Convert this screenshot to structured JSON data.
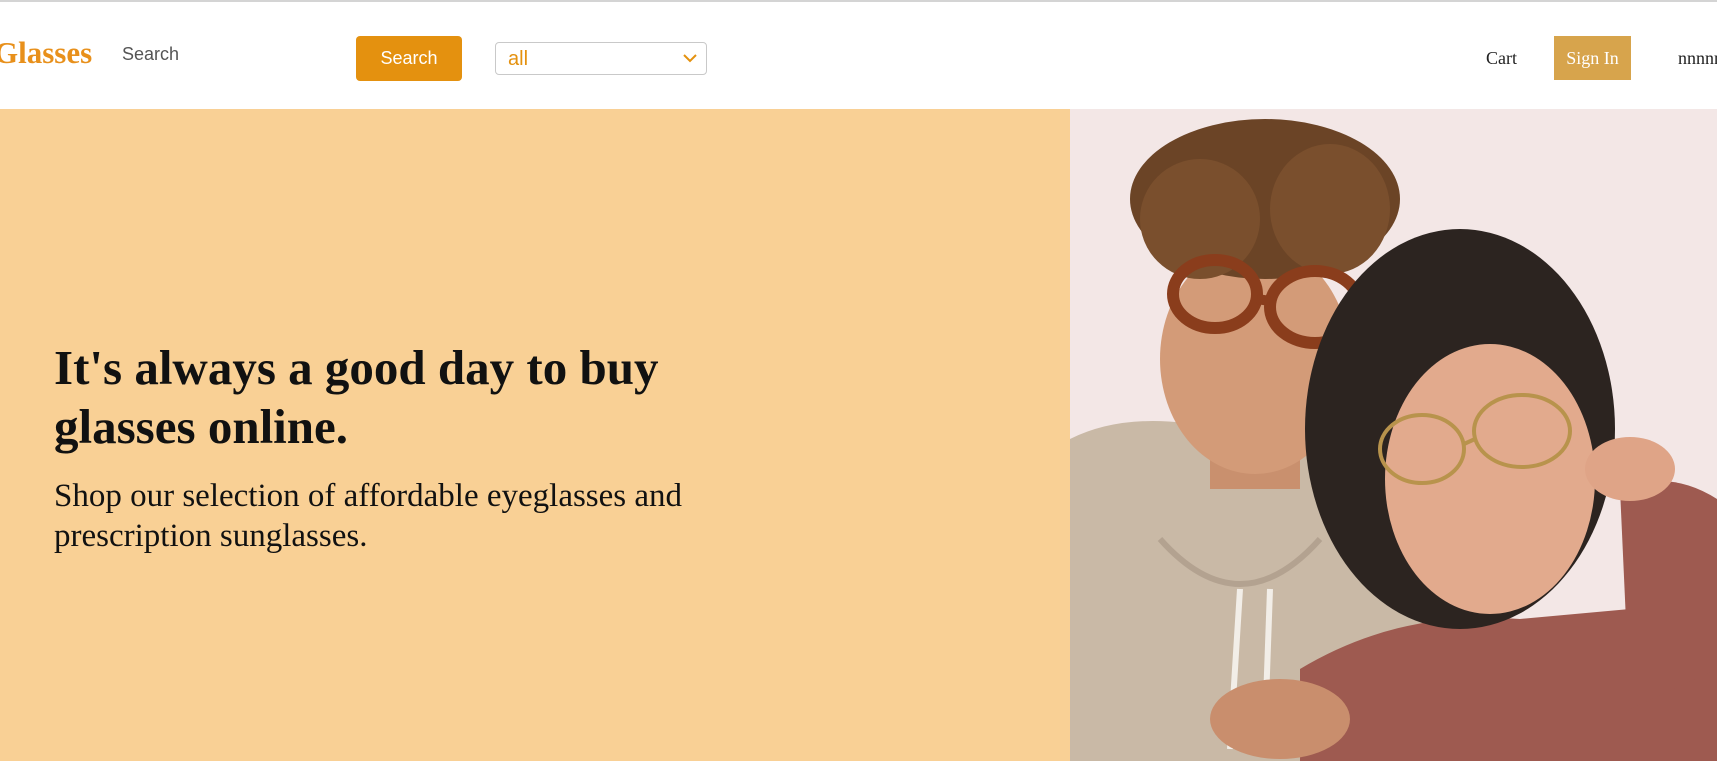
{
  "header": {
    "logo_text": "Glasses",
    "search": {
      "placeholder": "Search",
      "value": ""
    },
    "search_button_label": "Search",
    "category_select": {
      "selected": "all"
    },
    "cart_label": "Cart",
    "sign_in_label": "Sign In",
    "user_name": "nnnnn"
  },
  "hero": {
    "title": "It's always a good day to buy glasses online.",
    "subtitle": "Shop our selection of affordable eyeglasses and prescription sunglasses.",
    "image_icon": "hero-photo-couple-glasses"
  },
  "colors": {
    "brand_orange": "#e4910f",
    "hero_bg": "#f9d095",
    "sign_in_bg": "#d7a44c"
  }
}
